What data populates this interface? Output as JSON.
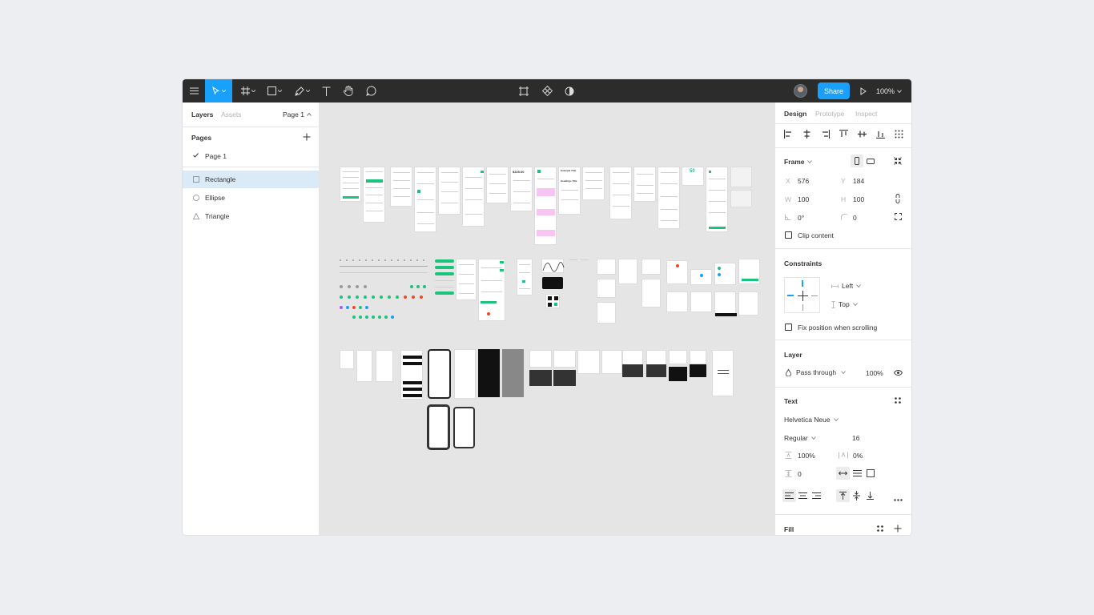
{
  "toolbar": {
    "share_label": "Share",
    "zoom_label": "100%"
  },
  "left_panel": {
    "tab_layers": "Layers",
    "tab_assets": "Assets",
    "page_selector": "Page 1",
    "pages_heading": "Pages",
    "pages": [
      {
        "label": "Page 1"
      }
    ],
    "layers": [
      {
        "label": "Rectangle",
        "icon": "rectangle-icon"
      },
      {
        "label": "Ellipse",
        "icon": "ellipse-icon"
      },
      {
        "label": "Triangle",
        "icon": "triangle-icon"
      }
    ]
  },
  "canvas": {
    "price_text": "$325.00",
    "fifty_text": "50",
    "example_title": "Example Title",
    "headings_title": "Headings Title"
  },
  "right_panel": {
    "tabs": {
      "design": "Design",
      "prototype": "Prototype",
      "inspect": "Inspect"
    },
    "frame": {
      "heading": "Frame",
      "x_label": "X",
      "x": "576",
      "y_label": "Y",
      "y": "184",
      "w_label": "W",
      "w": "100",
      "h_label": "H",
      "h": "100",
      "rotation": "0°",
      "radius": "0",
      "clip_content": "Clip content"
    },
    "constraints": {
      "heading": "Constraints",
      "horizontal": "Left",
      "vertical": "Top",
      "fix_position": "Fix position when scrolling"
    },
    "layer": {
      "heading": "Layer",
      "blend": "Pass through",
      "opacity": "100%"
    },
    "text": {
      "heading": "Text",
      "font_family": "Helvetica Neue",
      "font_weight": "Regular",
      "font_size": "16",
      "line_height": "100%",
      "letter_spacing": "0%",
      "paragraph_spacing": "0"
    },
    "fill": {
      "heading": "Fill"
    }
  },
  "colors": {
    "toolbar_bg": "#2c2c2c",
    "accent": "#18a0fb",
    "selection": "#daebf7",
    "canvas_bg": "#e5e5e5",
    "green": "#1bc47d"
  }
}
